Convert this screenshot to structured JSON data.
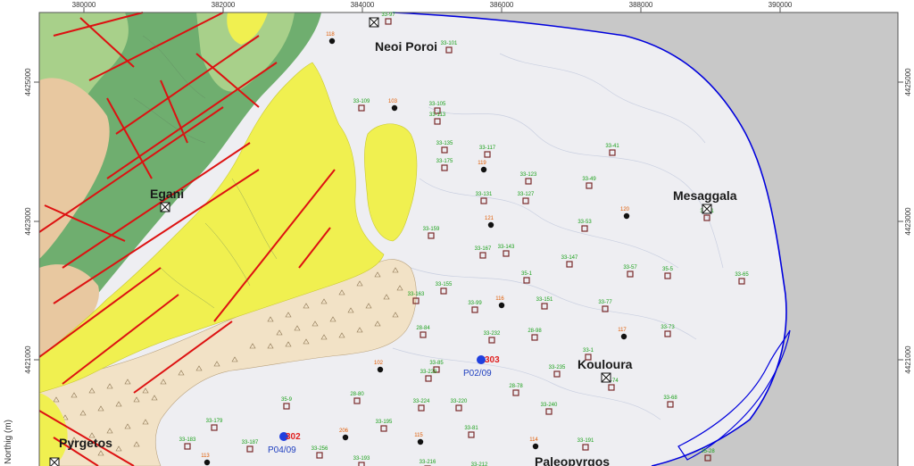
{
  "axes": {
    "top_ticks": [
      "380000",
      "382000",
      "384000",
      "386000",
      "388000",
      "390000"
    ],
    "right_ticks": [
      "4425000",
      "4423000",
      "4421000"
    ],
    "left_ticks": [
      "4425000",
      "4423000",
      "4421000"
    ],
    "y_axis_label": "Northig (m)"
  },
  "towns": [
    {
      "name": "Neoi Poroi"
    },
    {
      "name": "Egani"
    },
    {
      "name": "Mesaggala"
    },
    {
      "name": "Kouloura"
    },
    {
      "name": "Pyrgetos"
    },
    {
      "name": "Paleopyrgos"
    }
  ],
  "piezometers": [
    {
      "code": "P02/09",
      "number": "303"
    },
    {
      "code": "P04/09",
      "number": "302"
    }
  ],
  "wells_green": [
    "33-97",
    "33-101",
    "33-109",
    "33-105",
    "33-113",
    "33-117",
    "33-135",
    "33-175",
    "33-123",
    "33-127",
    "33-131",
    "33-49",
    "33-41",
    "33-61",
    "33-53",
    "33-159",
    "33-167",
    "33-143",
    "33-147",
    "33-57",
    "35-5",
    "33-65",
    "33-155",
    "33-163",
    "35-1",
    "33-151",
    "33-77",
    "33-99",
    "28-84",
    "33-232",
    "28-98",
    "33-73",
    "33-85",
    "33-228",
    "33-235",
    "33-1",
    "28-78",
    "28-74",
    "28-80",
    "35-9",
    "33-224",
    "33-220",
    "33-240",
    "33-68",
    "33-179",
    "33-183",
    "33-187",
    "33-195",
    "33-81",
    "33-256",
    "33-193",
    "33-216",
    "33-212",
    "33-191",
    "35-28"
  ],
  "wells_orange": [
    "118",
    "103",
    "119",
    "120",
    "121",
    "116",
    "117",
    "102",
    "206",
    "115",
    "113",
    "114"
  ],
  "colors": {
    "sea": "#c8c8c8",
    "plain": "#eeeef2",
    "coastline": "#0000dd",
    "fault": "#dd1111",
    "yellow_unit": "#f0f050",
    "green_dark": "#6fae6f",
    "green_light": "#a8d08a",
    "tan_unit": "#e8c8a0",
    "scree": "#f2e2c6"
  }
}
